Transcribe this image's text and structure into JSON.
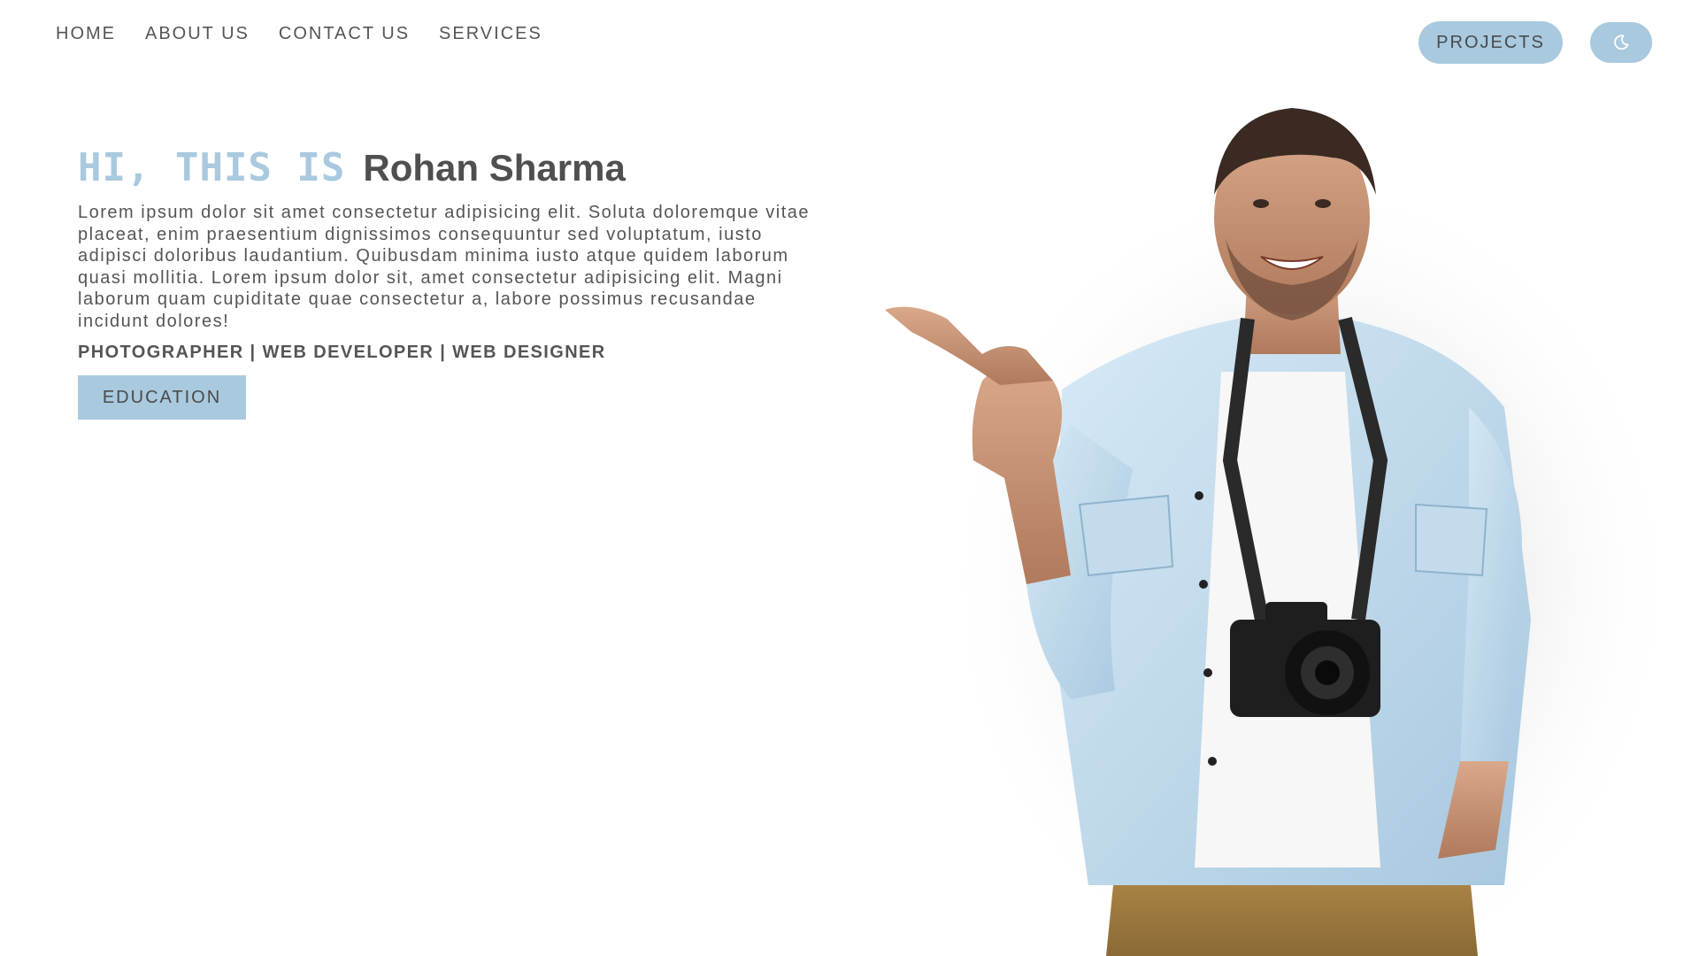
{
  "nav": {
    "items": [
      {
        "label": "HOME"
      },
      {
        "label": "ABOUT US"
      },
      {
        "label": "CONTACT US"
      },
      {
        "label": "SERVICES"
      }
    ]
  },
  "header": {
    "projects_label": "PROJECTS",
    "theme_icon": "moon-icon"
  },
  "hero": {
    "greeting": "HI, THIS IS",
    "name": "Rohan Sharma",
    "bio": "Lorem ipsum dolor sit amet consectetur adipisicing elit. Soluta doloremque vitae placeat, enim praesentium dignissimos consequuntur sed voluptatum, iusto adipisci doloribus laudantium. Quibusdam minima iusto atque quidem laborum quasi mollitia. Lorem ipsum dolor sit, amet consectetur adipisicing elit. Magni laborum quam cupiditate quae consectetur a, labore possimus recusandae incidunt dolores!",
    "roles": "PHOTOGRAPHER | WEB DEVELOPER | WEB DESIGNER",
    "education_label": "EDUCATION"
  },
  "colors": {
    "accent": "#a9c9df",
    "text": "#555555",
    "background": "#ffffff"
  }
}
